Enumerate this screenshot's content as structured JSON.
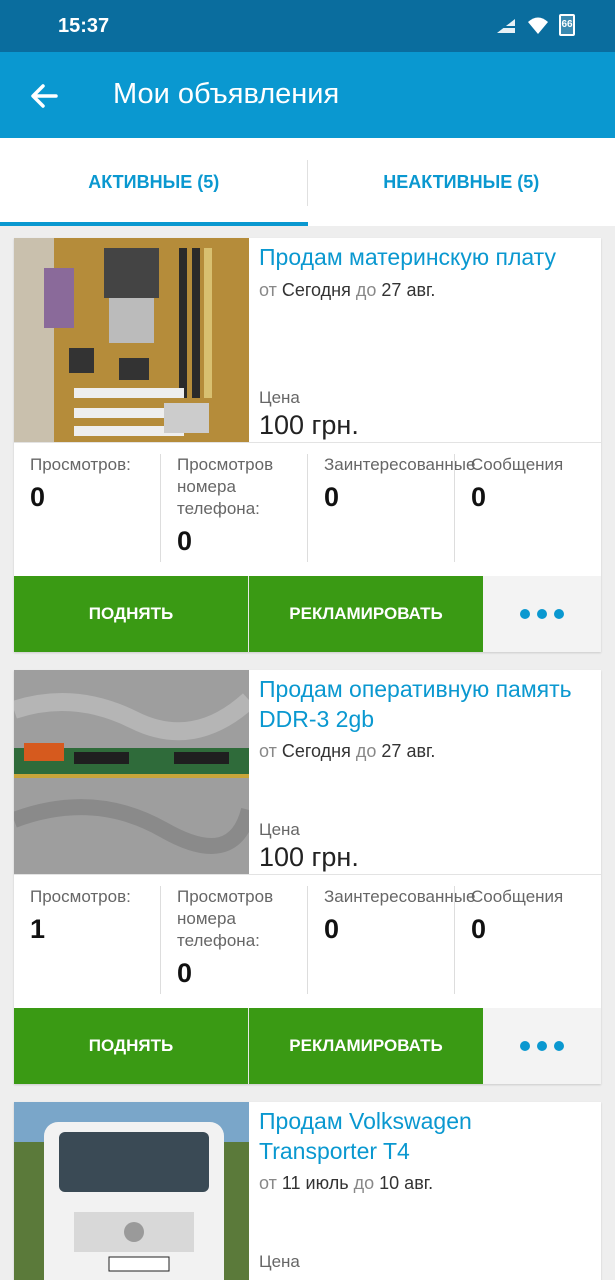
{
  "status_bar": {
    "time": "15:37",
    "battery": "66"
  },
  "app_bar": {
    "title": "Мои объявления"
  },
  "tabs": [
    {
      "label": "АКТИВНЫЕ (5)",
      "active": true
    },
    {
      "label": "НЕАКТИВНЫЕ (5)",
      "active": false
    }
  ],
  "common": {
    "from": "от",
    "to": "до",
    "price_label": "Цена",
    "stat_views": "Просмотров:",
    "stat_phone_views": "Просмотров номера телефона:",
    "stat_interested": "Заинтересованные",
    "stat_messages": "Сообщения",
    "btn_raise": "ПОДНЯТЬ",
    "btn_advertise": "РЕКЛАМИРОВАТЬ"
  },
  "listings": [
    {
      "title": "Продам материнскую плату",
      "date_from": "Сегодня",
      "date_to": "27 авг.",
      "price": "100 грн.",
      "views": "0",
      "phone_views": "0",
      "interested": "0",
      "messages": "0",
      "image": "motherboard-photo"
    },
    {
      "title": "Продам оперативную память DDR-3 2gb",
      "date_from": "Сегодня",
      "date_to": "27 авг.",
      "price": "100 грн.",
      "views": "1",
      "phone_views": "0",
      "interested": "0",
      "messages": "0",
      "image": "ram-module-photo"
    },
    {
      "title": "Продам Volkswagen Transporter T4",
      "date_from": "11 июль",
      "date_to": "10 авг.",
      "price": "",
      "image": "van-photo"
    }
  ],
  "colors": {
    "status_bar": "#0a6d9e",
    "app_bar": "#0a98d0",
    "accent": "#0a98d0",
    "button_green": "#3a9a14"
  }
}
